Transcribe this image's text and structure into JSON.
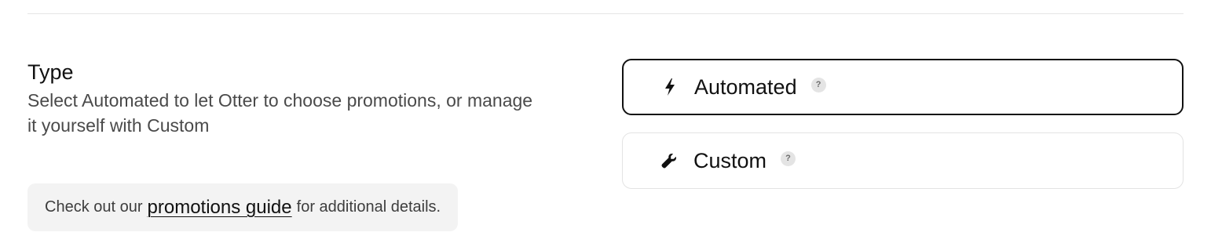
{
  "section": {
    "title": "Type",
    "description": "Select Automated to let Otter to choose promotions, or manage it yourself with Custom"
  },
  "guide_note": {
    "prefix": "Check out our",
    "link_text": "promotions guide",
    "suffix": "for additional details."
  },
  "options": [
    {
      "label": "Automated",
      "icon": "lightning-bolt-icon",
      "help": "?",
      "selected": true
    },
    {
      "label": "Custom",
      "icon": "wrench-icon",
      "help": "?",
      "selected": false
    }
  ],
  "colors": {
    "selected_border": "#111111",
    "unselected_border": "#e3e3e3",
    "note_background": "#f3f3f3"
  }
}
